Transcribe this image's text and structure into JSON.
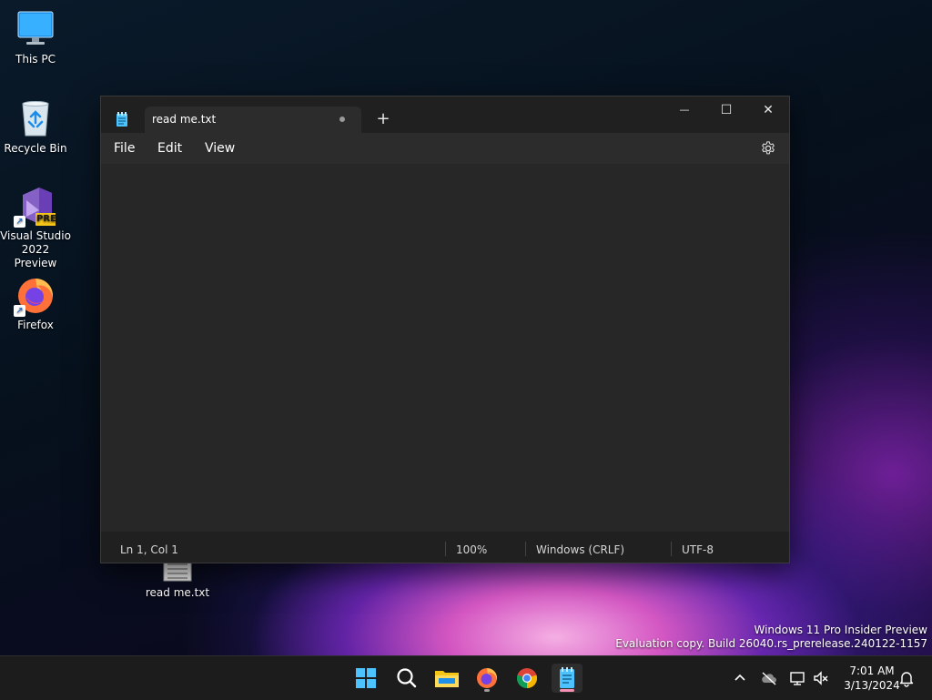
{
  "desktop": {
    "icons": [
      {
        "label": "This PC"
      },
      {
        "label": "Recycle Bin"
      },
      {
        "label_line1": "Visual Studio",
        "label_line2": "2022 Preview",
        "badge": "PRE"
      },
      {
        "label": "Firefox"
      },
      {
        "label": "read me.txt"
      }
    ]
  },
  "notepad": {
    "tab_title": "read me.txt",
    "new_tab_symbol": "+",
    "controls": {
      "minimize": "—",
      "maximize": "☐",
      "close": "✕"
    },
    "menu": {
      "file": "File",
      "edit": "Edit",
      "view": "View"
    },
    "editor_content": "",
    "status": {
      "position": "Ln 1, Col 1",
      "zoom": "100%",
      "line_ending": "Windows (CRLF)",
      "encoding": "UTF-8"
    }
  },
  "watermark": {
    "line1": "Windows 11 Pro Insider Preview",
    "line2": "Evaluation copy. Build 26040.rs_prerelease.240122-1157"
  },
  "taskbar": {
    "time": "7:01 AM",
    "date": "3/13/2024"
  },
  "colors": {
    "accent": "#4cc2ff",
    "notepad_accent": "#f48fb1",
    "folder": "#f5c518"
  }
}
